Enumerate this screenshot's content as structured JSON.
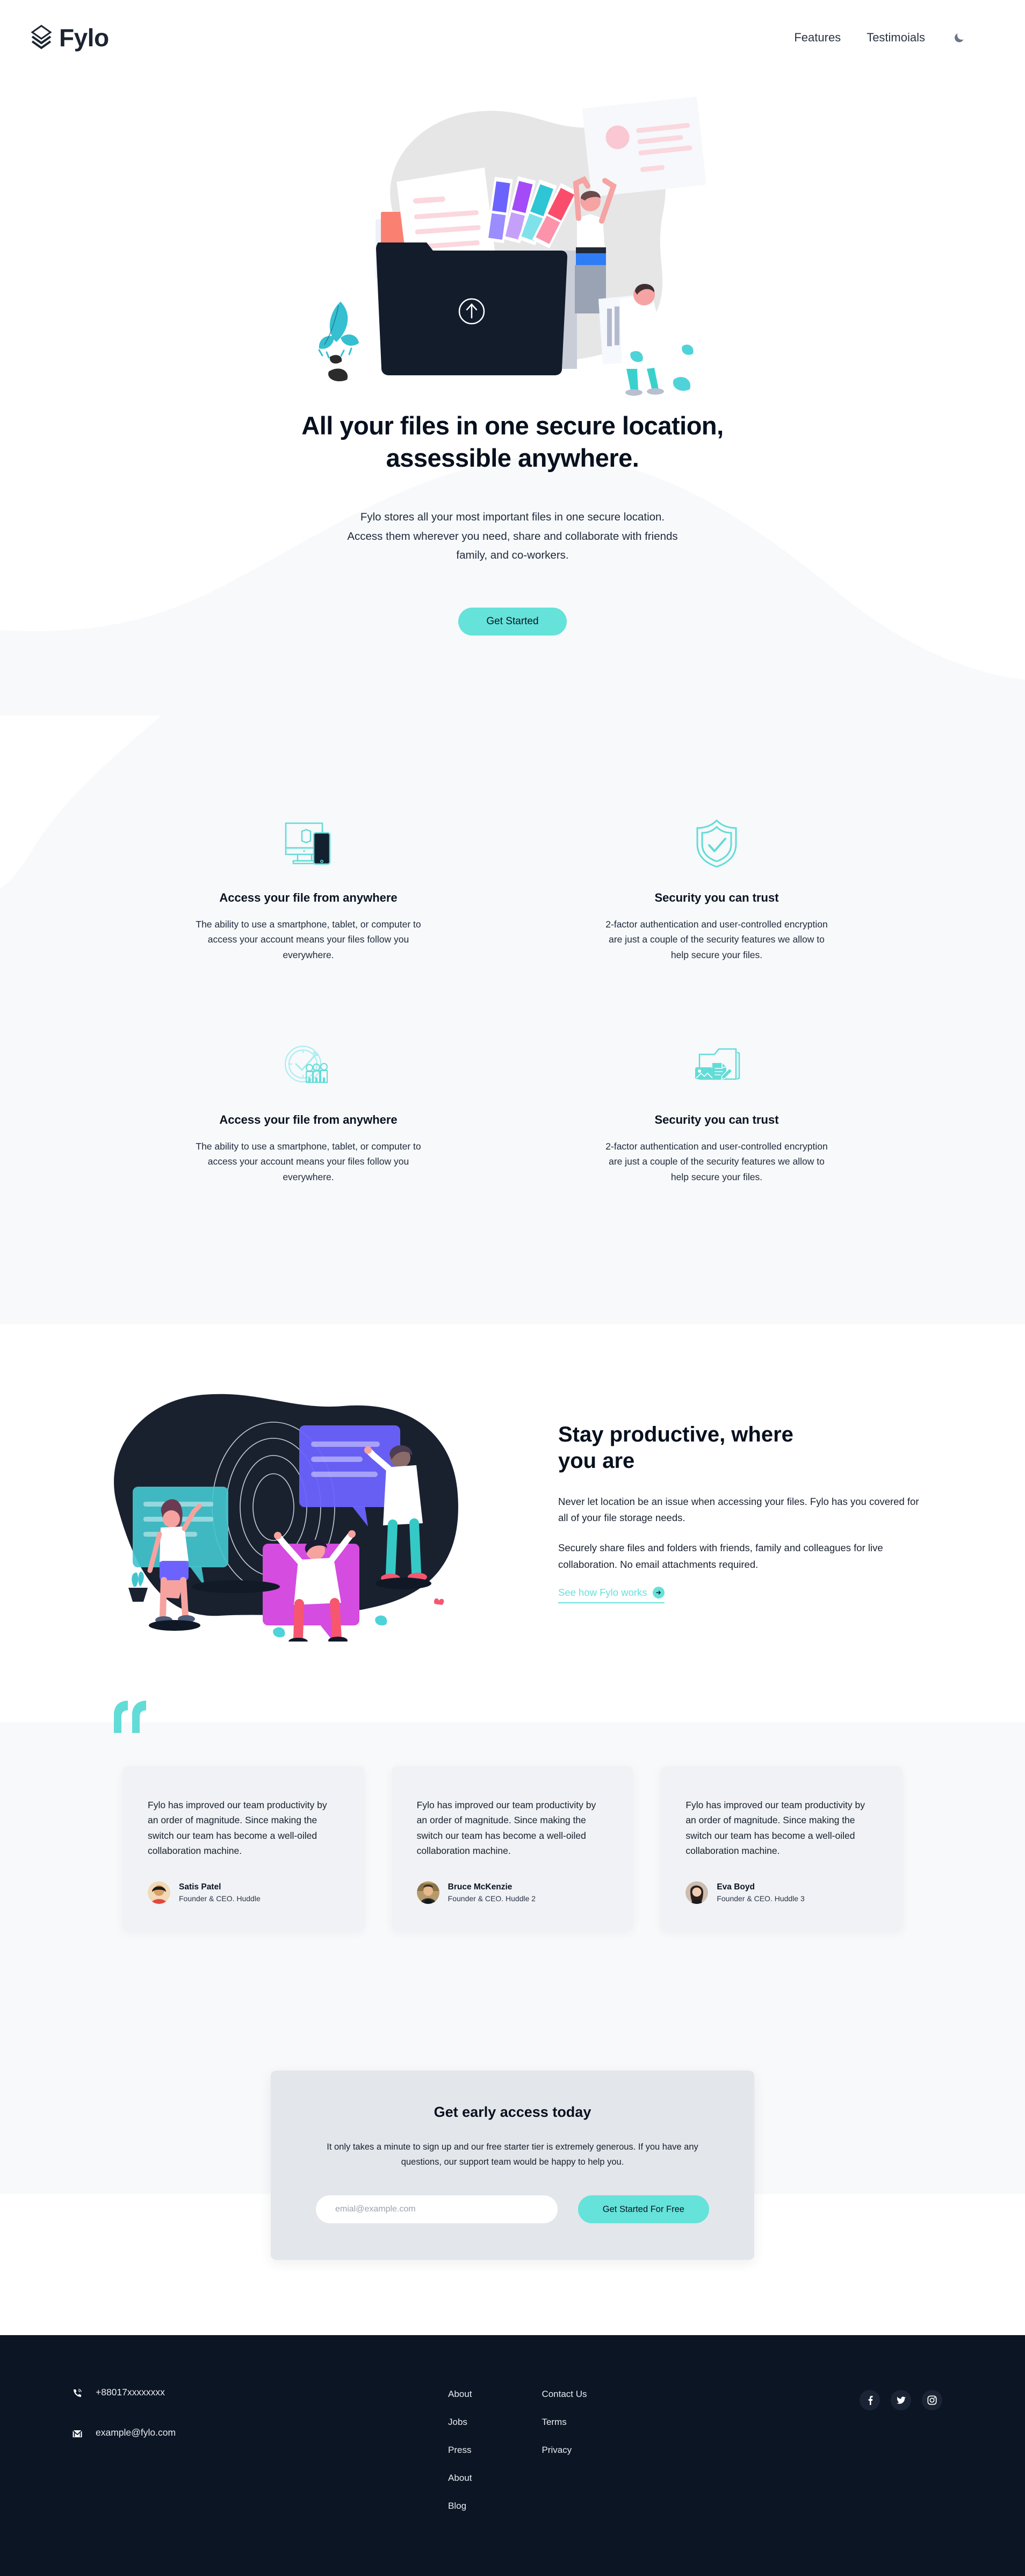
{
  "brand": {
    "name": "Fylo",
    "accent": "#65E2D9",
    "dark": "#0B1524",
    "light_section": "#F7F9FB"
  },
  "header": {
    "logo_text": "Fylo",
    "nav": [
      {
        "label": "Features"
      },
      {
        "label": "Testimoials"
      }
    ],
    "theme_icon": "moon-icon"
  },
  "hero": {
    "title_line1": "All your files in one secure location,",
    "title_line2": "assessible anywhere.",
    "sub_line1": "Fylo stores all your most important files in one secure location.",
    "sub_line2": "Access them wherever you need, share and collaborate with friends",
    "sub_line3": "family, and co-workers.",
    "cta_label": "Get Started"
  },
  "features": [
    {
      "icon": "monitor-phone-icon",
      "title": "Access your file from anywhere",
      "desc": "The ability to use a smartphone, tablet, or computer to access your account means your files follow you everywhere."
    },
    {
      "icon": "shield-check-icon",
      "title": "Security you can trust",
      "desc": "2-factor authentication and user-controlled encryption are just a couple of the security features we allow to help secure your files."
    },
    {
      "icon": "clock-people-icon",
      "title": "Access your file from anywhere",
      "desc": "The ability to use a smartphone, tablet, or computer to access your account means your files follow you everywhere."
    },
    {
      "icon": "folder-files-icon",
      "title": "Security you can trust",
      "desc": "2-factor authentication and user-controlled encryption are just a couple of the security features we allow to help secure your files."
    }
  ],
  "productive": {
    "title": "Stay productive, where you are",
    "paragraph1": "Never let location be an issue when accessing your files. Fylo has you covered for all of your file storage needs.",
    "paragraph2": "Securely share files and folders with friends, family and colleagues for live collaboration. No email attachments required.",
    "link_label": "See how Fylo works",
    "link_icon": "arrow-right-circle-icon"
  },
  "testimonials": {
    "quote_icon": "quote-mark-icon",
    "items": [
      {
        "text": "Fylo has improved our team productivity by an order of magnitude. Since making the switch our team has become a well-oiled collaboration machine.",
        "name": "Satis Patel",
        "role": "Founder & CEO. Huddle"
      },
      {
        "text": "Fylo has improved our team productivity by an order of magnitude. Since making the switch our team has become a well-oiled collaboration machine.",
        "name": "Bruce McKenzie",
        "role": "Founder & CEO. Huddle 2"
      },
      {
        "text": "Fylo has improved our team productivity by an order of magnitude. Since making the switch our team has become a well-oiled collaboration machine.",
        "name": "Eva Boyd",
        "role": "Founder & CEO. Huddle 3"
      }
    ]
  },
  "cta": {
    "title": "Get early access today",
    "desc": "It only takes a minute to sign up and our free starter tier is extremely generous. If you have any questions, our support team would be happy to help you.",
    "email_placeholder": "emial@example.com",
    "email_value": "",
    "button_label": "Get Started For Free"
  },
  "footer": {
    "phone_icon": "phone-icon",
    "phone": "+88017xxxxxxxx",
    "email_icon": "mail-icon",
    "email": "example@fylo.com",
    "links_col1": [
      {
        "label": "About"
      },
      {
        "label": "Jobs"
      },
      {
        "label": "Press"
      },
      {
        "label": "About"
      },
      {
        "label": "Blog"
      }
    ],
    "links_col2": [
      {
        "label": "Contact Us"
      },
      {
        "label": "Terms"
      },
      {
        "label": "Privacy"
      }
    ],
    "social": [
      {
        "icon": "facebook-icon"
      },
      {
        "icon": "twitter-icon"
      },
      {
        "icon": "instagram-icon"
      }
    ]
  }
}
